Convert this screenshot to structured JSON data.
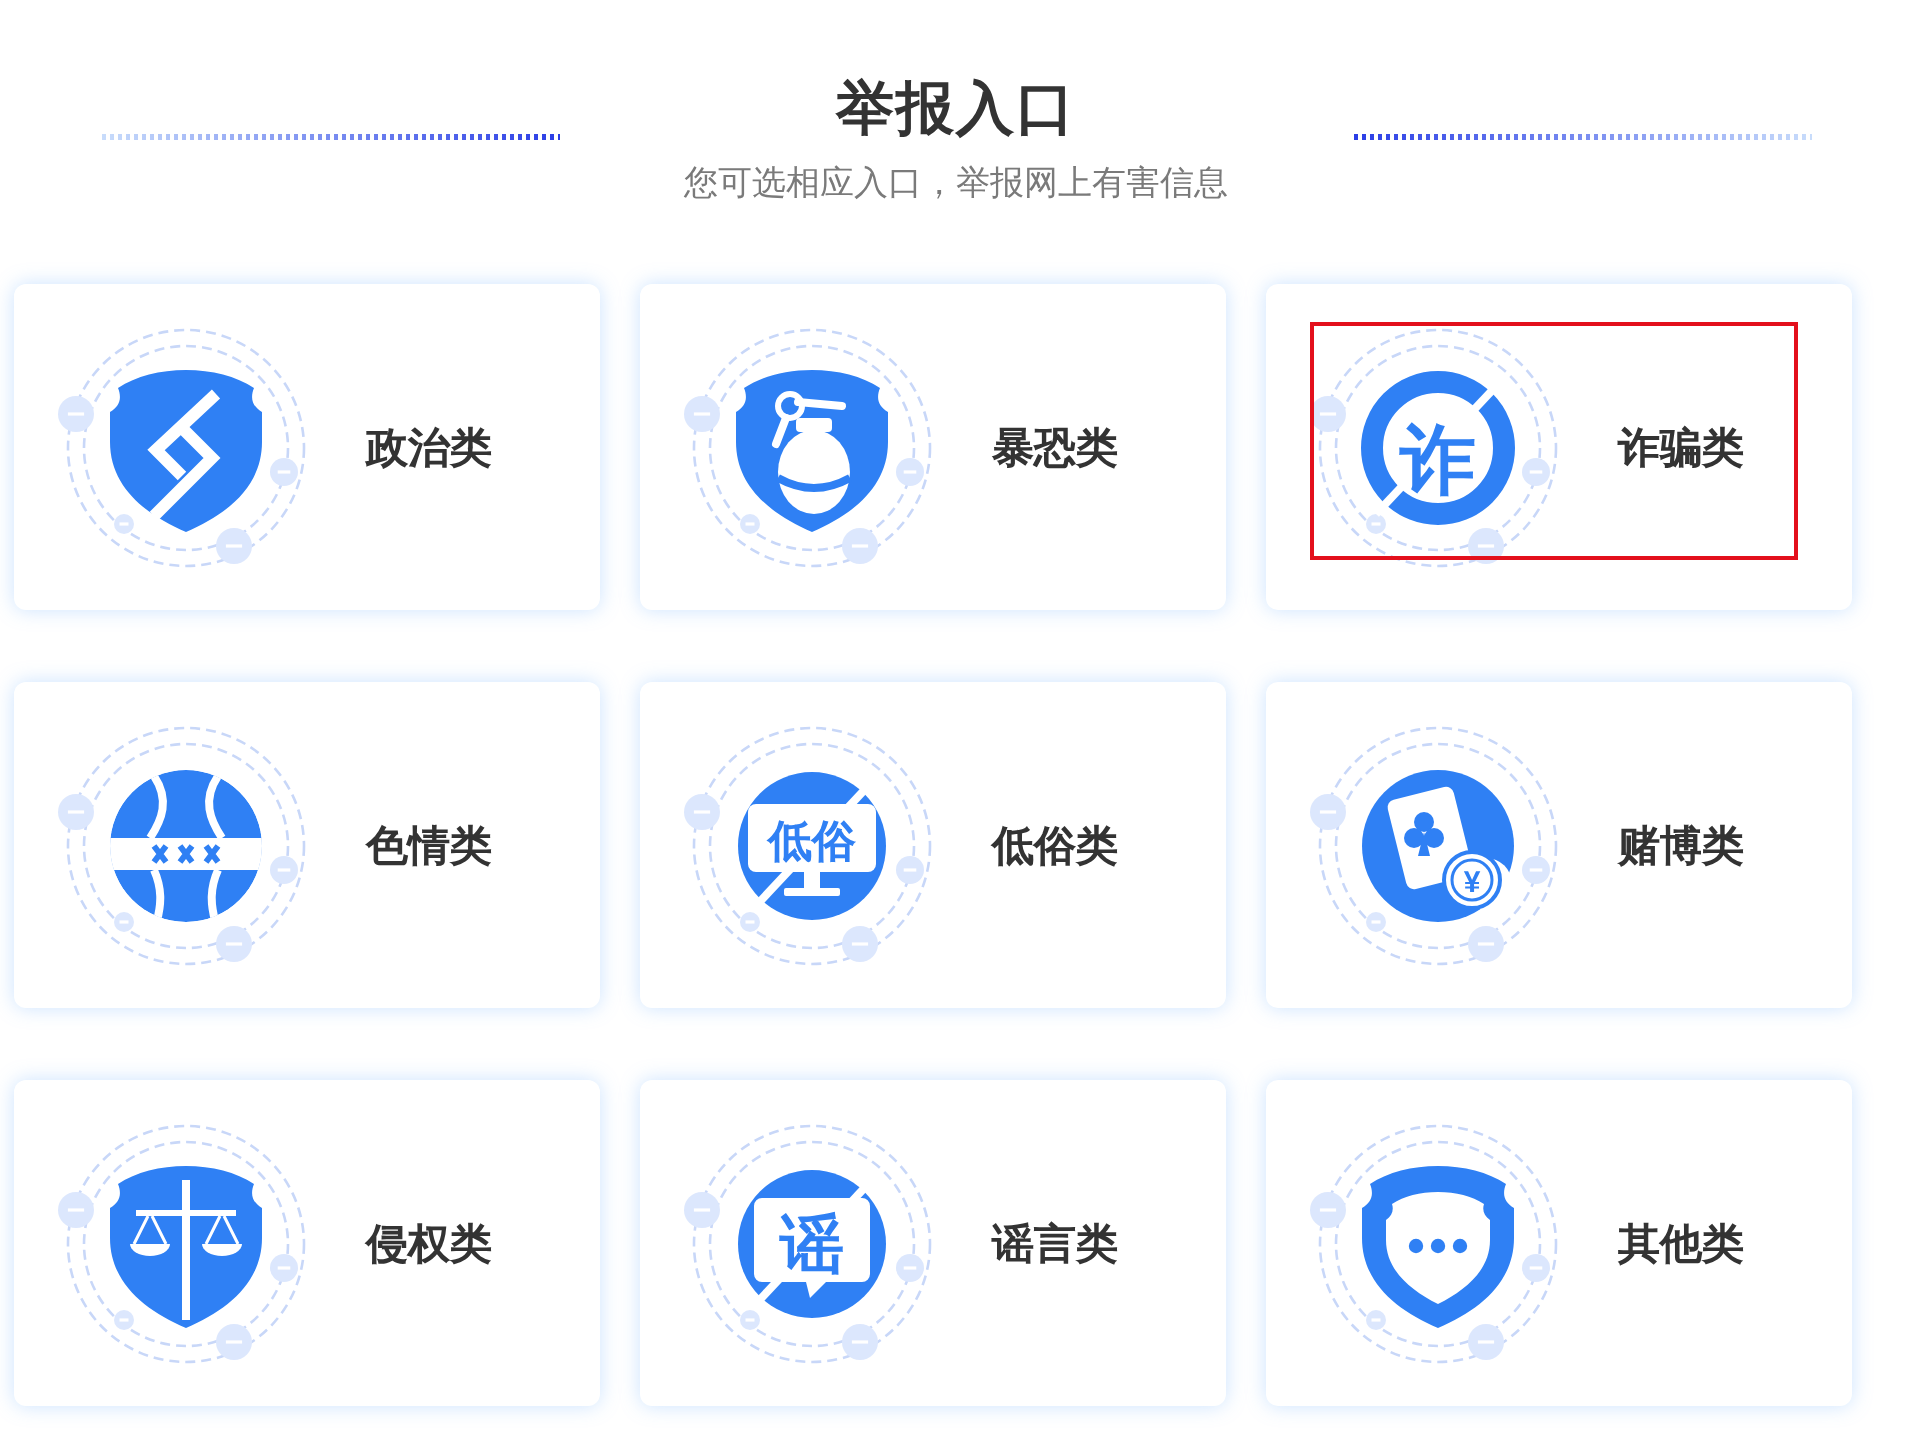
{
  "header": {
    "title": "举报入口",
    "subtitle": "您可选相应入口，举报网上有害信息"
  },
  "cards": [
    {
      "label": "政治类",
      "kind": "shield-link",
      "highlighted": false
    },
    {
      "label": "暴恐类",
      "kind": "grenade-shield",
      "highlighted": false
    },
    {
      "label": "诈骗类",
      "kind": "crossed-character",
      "icon_text": "诈",
      "highlighted": true
    },
    {
      "label": "色情类",
      "kind": "body-crossed",
      "highlighted": false
    },
    {
      "label": "低俗类",
      "kind": "crossed-monitor",
      "icon_text": "低俗",
      "highlighted": false
    },
    {
      "label": "赌博类",
      "kind": "card-coin",
      "icon_text": "¥",
      "highlighted": false
    },
    {
      "label": "侵权类",
      "kind": "scales-shield",
      "highlighted": false
    },
    {
      "label": "谣言类",
      "kind": "crossed-bubble",
      "icon_text": "谣",
      "highlighted": false
    },
    {
      "label": "其他类",
      "kind": "dots-shield",
      "highlighted": false
    }
  ]
}
